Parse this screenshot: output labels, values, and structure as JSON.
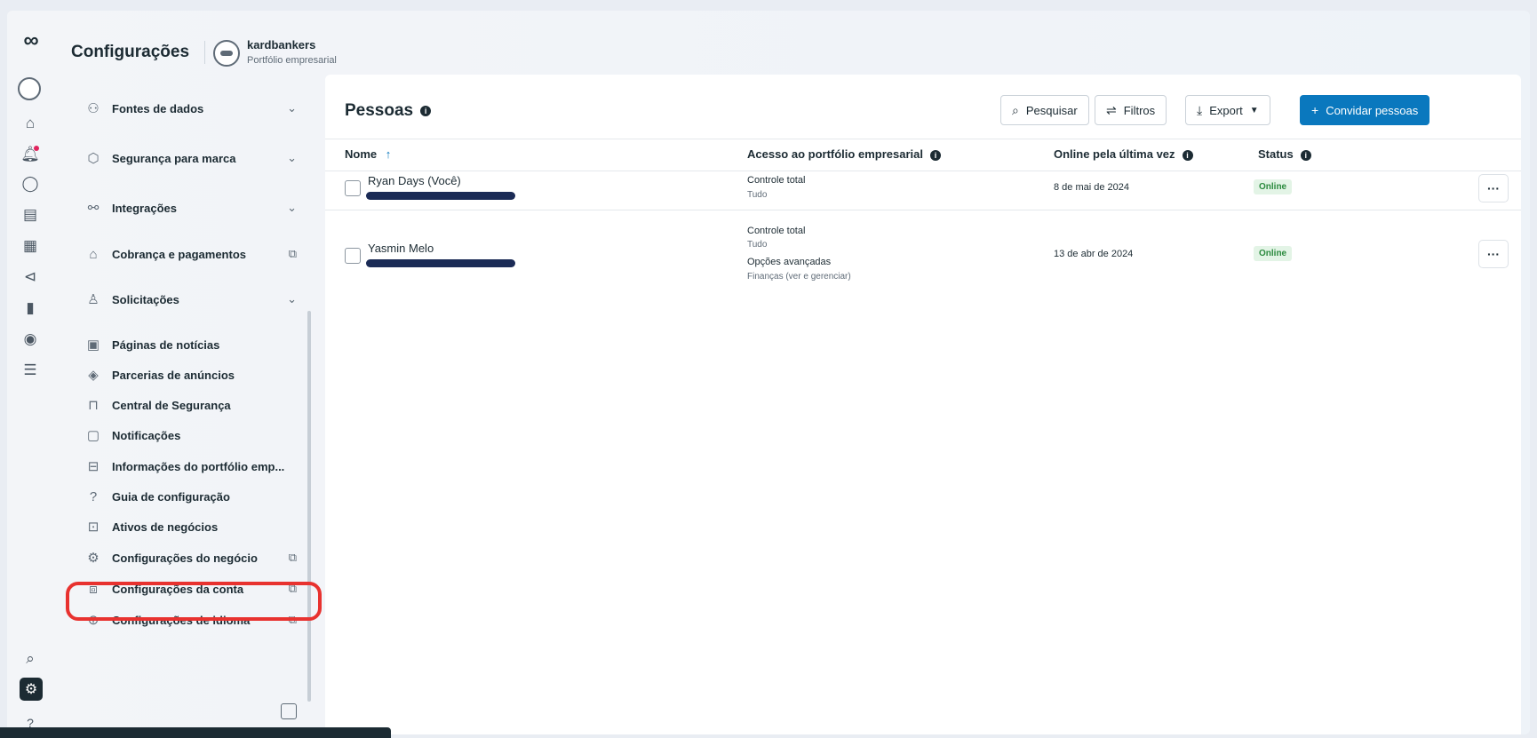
{
  "header": {
    "title": "Configurações",
    "account_name": "kardbankers",
    "account_type": "Portfólio empresarial"
  },
  "rail": {
    "icons": [
      "meta-logo-icon",
      "avatar",
      "home-icon",
      "notifications-icon",
      "chat-icon",
      "inbox-icon",
      "calendar-icon",
      "megaphone-icon",
      "bar-chart-icon",
      "compass-icon",
      "menu-icon",
      "search-icon",
      "gear-icon",
      "help-icon"
    ],
    "logo_glyph": "∞",
    "help_glyph": "?"
  },
  "sidebar": {
    "items": [
      {
        "label": "Fontes de dados",
        "icon": "data-sources-icon",
        "end": "chevron"
      },
      {
        "label": "Segurança para marca",
        "icon": "shield-icon",
        "end": "chevron"
      },
      {
        "label": "Integrações",
        "icon": "integrations-icon",
        "end": "chevron"
      },
      {
        "label": "Cobrança e pagamentos",
        "icon": "bank-icon",
        "end": "external"
      },
      {
        "label": "Solicitações",
        "icon": "requests-icon",
        "end": "chevron"
      },
      {
        "label": "Páginas de notícias",
        "icon": "newspaper-icon",
        "end": ""
      },
      {
        "label": "Parcerias de anúncios",
        "icon": "handshake-icon",
        "end": ""
      },
      {
        "label": "Central de Segurança",
        "icon": "lock-icon",
        "end": ""
      },
      {
        "label": "Notificações",
        "icon": "notification-icon",
        "end": ""
      },
      {
        "label": "Informações do portfólio emp...",
        "icon": "briefcase-icon",
        "end": ""
      },
      {
        "label": "Guia de configuração",
        "icon": "question-circle-icon",
        "end": ""
      },
      {
        "label": "Ativos de negócios",
        "icon": "assets-icon",
        "end": ""
      },
      {
        "label": "Configurações do negócio",
        "icon": "gear-icon",
        "end": "external"
      },
      {
        "label": "Configurações da conta",
        "icon": "account-settings-icon",
        "end": "external"
      },
      {
        "label": "Configurações de idioma",
        "icon": "globe-icon",
        "end": "external"
      }
    ]
  },
  "main": {
    "title": "Pessoas",
    "toolbar": {
      "search_label": "Pesquisar",
      "filters_label": "Filtros",
      "export_label": "Export",
      "invite_label": "Convidar pessoas"
    },
    "columns": [
      "Nome",
      "Acesso ao portfólio empresarial",
      "Online pela última vez",
      "Status"
    ],
    "sort_glyph": "↑",
    "rows": [
      {
        "name": "Ryan Days (Você)",
        "access": "Controle total",
        "access_scope": "Tudo",
        "advanced": "",
        "advanced_scope": "",
        "last_online": "8 de mai de 2024",
        "status": "Online"
      },
      {
        "name": "Yasmin Melo",
        "access": "Controle total",
        "access_scope": "Tudo",
        "advanced": "Opções avançadas",
        "advanced_scope": "Finanças (ver e gerenciar)",
        "last_online": "13 de abr de 2024",
        "status": "Online"
      }
    ],
    "more_glyph": "···"
  },
  "colors": {
    "primary": "#0a78be",
    "highlight": "#e8322f",
    "online_badge": "#2b8a3e",
    "redaction": "#1b2b56"
  }
}
